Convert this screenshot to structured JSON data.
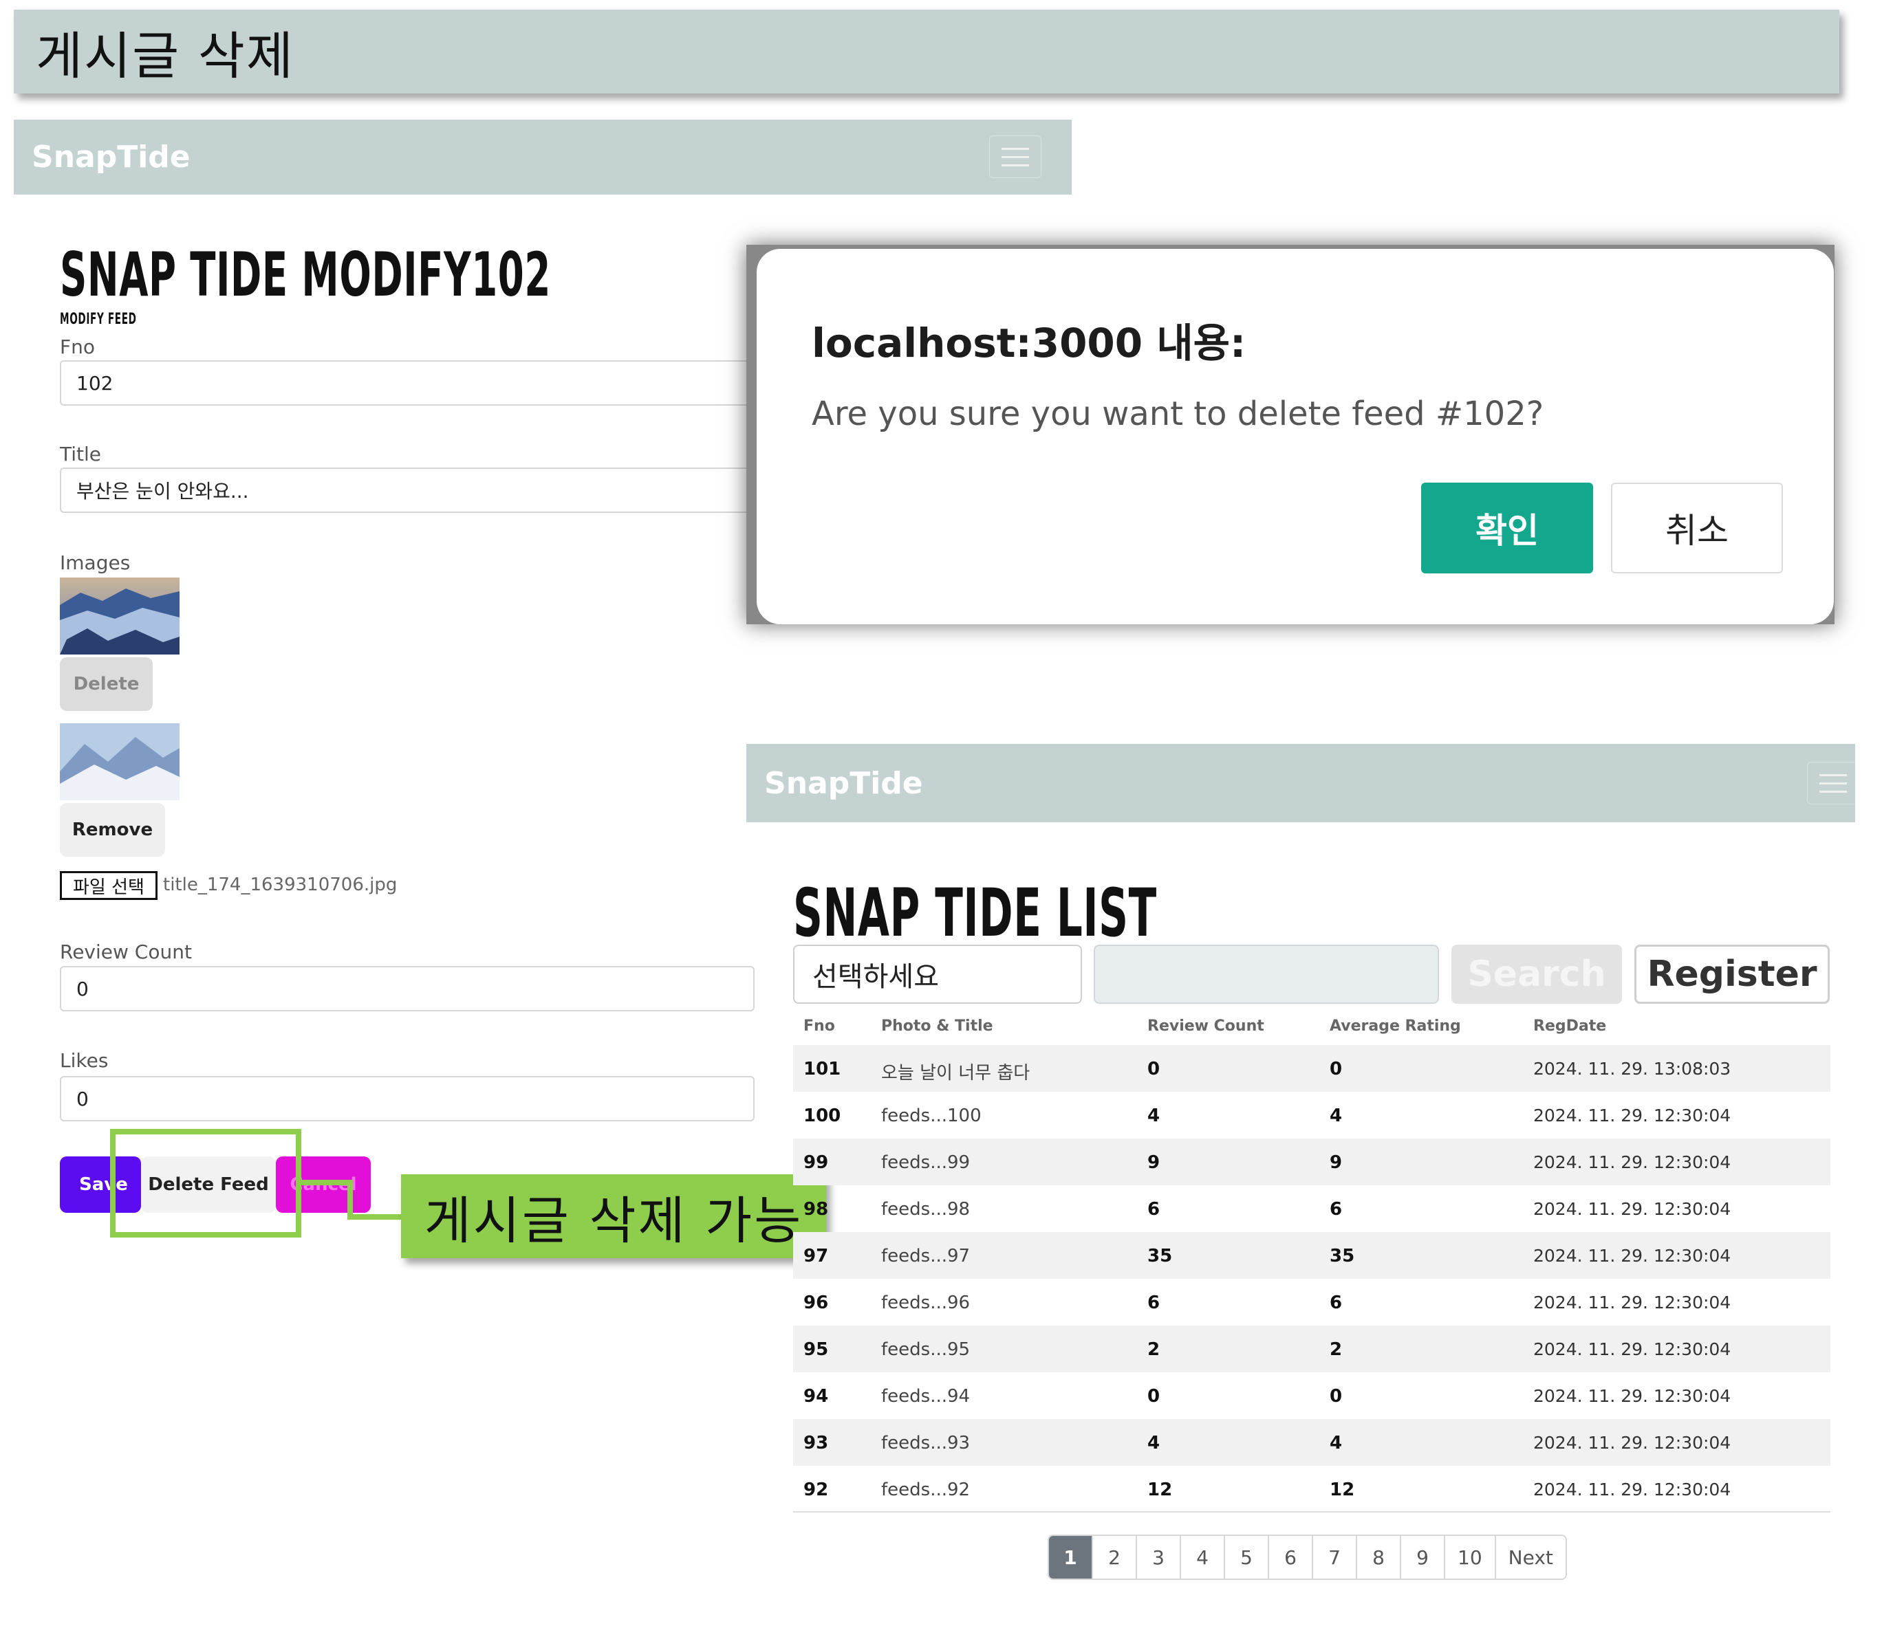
{
  "slide_title": "게시글 삭제",
  "annotation": {
    "label": "게시글 삭제 가능"
  },
  "modify_page": {
    "brand": "SnapTide",
    "title": "SNAP TIDE  MODIFY102",
    "subtitle": "MODIFY FEED",
    "fno_label": "Fno",
    "fno_value": "102",
    "title_label": "Title",
    "title_value": "부산은 눈이 안와요...",
    "images_label": "Images",
    "delete_image_label": "Delete",
    "remove_image_label": "Remove",
    "file_button_label": "파일 선택",
    "file_name": "title_174_1639310706.jpg",
    "review_count_label": "Review Count",
    "review_count_value": "0",
    "likes_label": "Likes",
    "likes_value": "0",
    "save_label": "Save",
    "delete_feed_label": "Delete Feed",
    "cancel_label": "Cancel",
    "colors": {
      "save": "#5b0cf0",
      "cancel": "#e20fd9"
    }
  },
  "dialog": {
    "title": "localhost:3000 내용:",
    "message": "Are you sure you want to delete feed #102?",
    "ok_label": "확인",
    "cancel_label": "취소",
    "ok_color": "#13a88e"
  },
  "list_page": {
    "brand": "SnapTide",
    "title": "SNAP TIDE  LIST",
    "select_value": "선택하세요",
    "search_label": "Search",
    "register_label": "Register",
    "columns": [
      "Fno",
      "Photo & Title",
      "Review Count",
      "Average Rating",
      "RegDate"
    ],
    "rows": [
      {
        "fno": "101",
        "title": "오늘 날이 너무 춥다",
        "review_count": "0",
        "avg_rating": "0",
        "regdate": "2024. 11. 29. 13:08:03"
      },
      {
        "fno": "100",
        "title": "feeds...100",
        "review_count": "4",
        "avg_rating": "4",
        "regdate": "2024. 11. 29. 12:30:04"
      },
      {
        "fno": "99",
        "title": "feeds...99",
        "review_count": "9",
        "avg_rating": "9",
        "regdate": "2024. 11. 29. 12:30:04"
      },
      {
        "fno": "98",
        "title": "feeds...98",
        "review_count": "6",
        "avg_rating": "6",
        "regdate": "2024. 11. 29. 12:30:04"
      },
      {
        "fno": "97",
        "title": "feeds...97",
        "review_count": "35",
        "avg_rating": "35",
        "regdate": "2024. 11. 29. 12:30:04"
      },
      {
        "fno": "96",
        "title": "feeds...96",
        "review_count": "6",
        "avg_rating": "6",
        "regdate": "2024. 11. 29. 12:30:04"
      },
      {
        "fno": "95",
        "title": "feeds...95",
        "review_count": "2",
        "avg_rating": "2",
        "regdate": "2024. 11. 29. 12:30:04"
      },
      {
        "fno": "94",
        "title": "feeds...94",
        "review_count": "0",
        "avg_rating": "0",
        "regdate": "2024. 11. 29. 12:30:04"
      },
      {
        "fno": "93",
        "title": "feeds...93",
        "review_count": "4",
        "avg_rating": "4",
        "regdate": "2024. 11. 29. 12:30:04"
      },
      {
        "fno": "92",
        "title": "feeds...92",
        "review_count": "12",
        "avg_rating": "12",
        "regdate": "2024. 11. 29. 12:30:04"
      }
    ],
    "pages": [
      "1",
      "2",
      "3",
      "4",
      "5",
      "6",
      "7",
      "8",
      "9",
      "10"
    ],
    "active_page": "1",
    "next_label": "Next"
  }
}
